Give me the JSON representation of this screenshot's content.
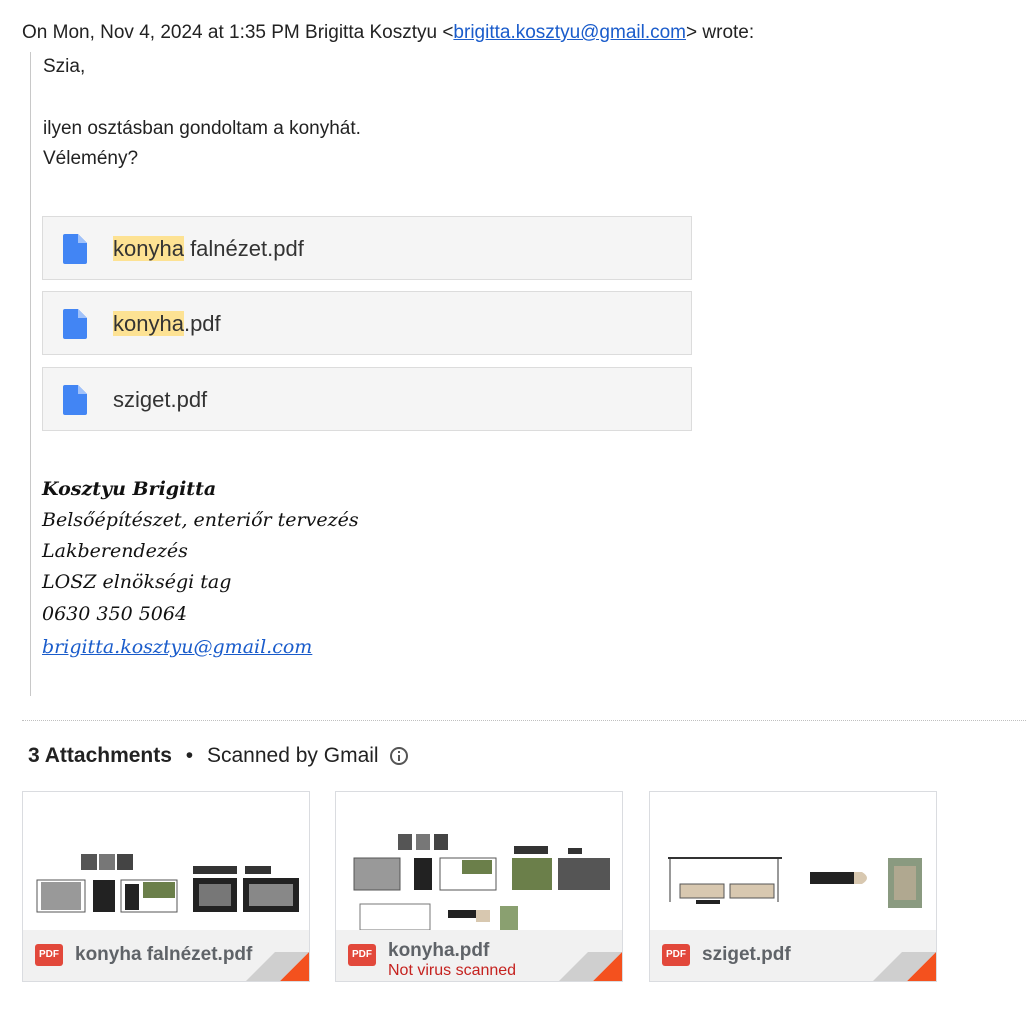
{
  "quote": {
    "header_prefix": "On Mon, Nov 4, 2024 at 1:35 PM Brigitta Kosztyu <",
    "header_email": "brigitta.kosztyu@gmail.com",
    "header_suffix": "> wrote:",
    "lines": [
      "Szia,",
      "ilyen osztásban gondoltam a konyhát.",
      "Vélemény?"
    ]
  },
  "inline_attachments": [
    {
      "highlight": "konyha",
      "rest": " falnézet.pdf"
    },
    {
      "highlight": "konyha",
      "rest": ".pdf"
    },
    {
      "highlight": "",
      "rest": "sziget.pdf"
    }
  ],
  "signature": {
    "name": "Kosztyu Brigitta",
    "lines": [
      "Belsőépítészet, enteriőr tervezés",
      "Lakberendezés",
      "LOSZ elnökségi tag",
      "0630 350 5064"
    ],
    "email": "brigitta.kosztyu@gmail.com"
  },
  "attachments_section": {
    "count_label": "3 Attachments",
    "separator": "•",
    "scanned_label": "Scanned by Gmail",
    "info_icon": "info-icon",
    "files": [
      {
        "name": "konyha falnézet.pdf",
        "badge": "PDF",
        "status": ""
      },
      {
        "name": "konyha.pdf",
        "badge": "PDF",
        "status": "Not virus scanned"
      },
      {
        "name": "sziget.pdf",
        "badge": "PDF",
        "status": ""
      }
    ]
  },
  "colors": {
    "link": "#1a5ccb",
    "highlight": "#fde293",
    "pdf_red": "#e2483b",
    "doc_blue": "#4285f4",
    "warning_red": "#c5221f"
  }
}
